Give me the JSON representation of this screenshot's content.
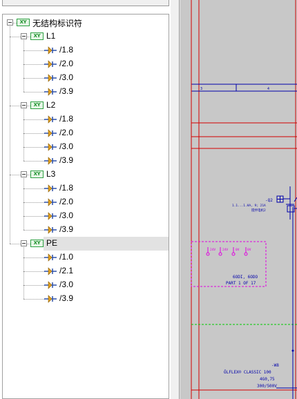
{
  "tree": {
    "root": {
      "label": "无结构标识符",
      "icon": "xy-icon"
    },
    "groups": [
      {
        "label": "L1",
        "icon": "xy-icon",
        "items": [
          "/1.8",
          "/2.0",
          "/3.0",
          "/3.9"
        ]
      },
      {
        "label": "L2",
        "icon": "xy-icon",
        "items": [
          "/1.8",
          "/2.0",
          "/3.0",
          "/3.9"
        ]
      },
      {
        "label": "L3",
        "icon": "xy-icon",
        "items": [
          "/1.8",
          "/2.0",
          "/3.0",
          "/3.9"
        ]
      },
      {
        "label": "PE",
        "icon": "xy-icon",
        "items": [
          "/1.0",
          "/2.1",
          "/3.0",
          "/3.9"
        ]
      }
    ],
    "selected_group": "PE",
    "xy_badge": "XY"
  },
  "drawing": {
    "title_cells": [
      "3",
      "4"
    ],
    "q2_label": "-Q2",
    "q2_sub1": "1.1...1.HA, 9; 21A",
    "q2_sub2": "搅拌电机2",
    "io_labels": [
      "24V",
      "24V",
      "0V",
      "0V"
    ],
    "io_desc1": "6ODI, 6ODO",
    "io_desc2": "PART 1 OF 17",
    "cable_tag": "-W8",
    "cable_type": "ÖLFLEX® CLASSIC 100",
    "cable_spec1": "4G0,75",
    "cable_spec2": "300/500V",
    "colors": {
      "frame": "#d40000",
      "title_line": "#0000aa",
      "plc_box": "#e000e0",
      "ground": "#00cc00",
      "component": "#0000aa"
    }
  }
}
